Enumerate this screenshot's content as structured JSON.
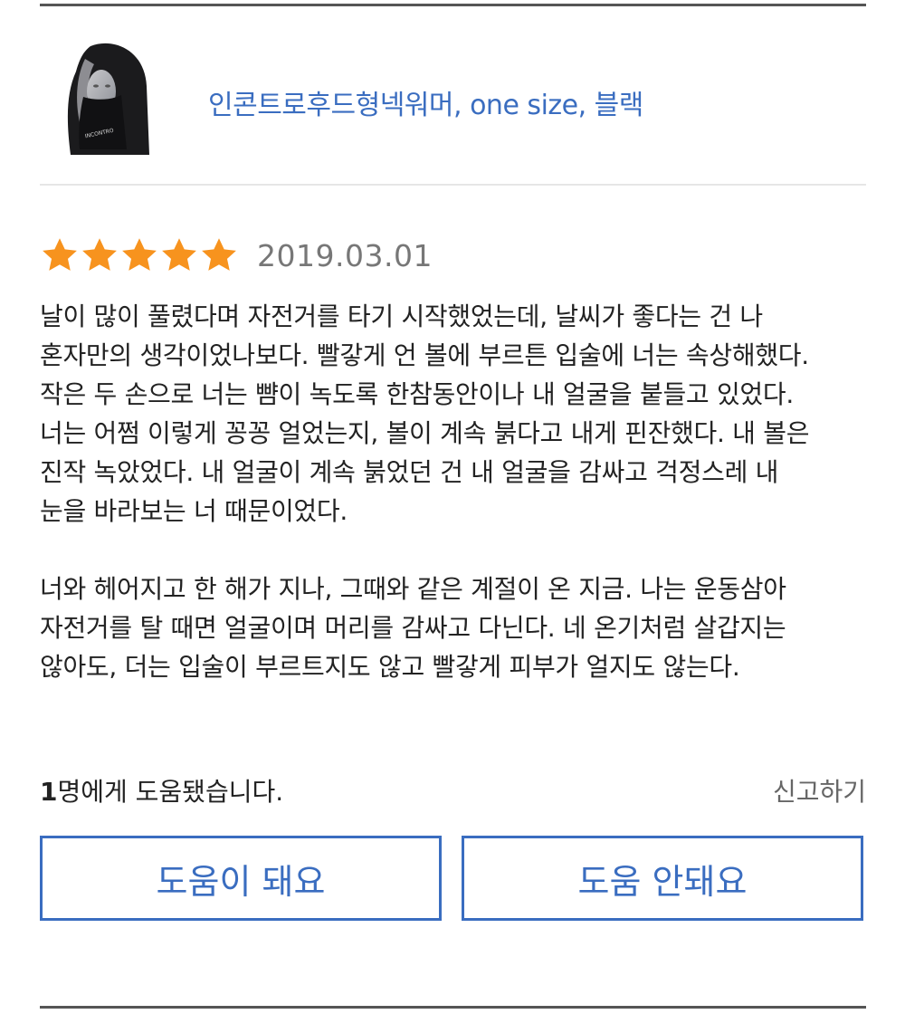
{
  "product": {
    "name": "인콘트로후드형넥워머, one size, 블랙",
    "thumbnail_text": "INCONTRO"
  },
  "review": {
    "rating": 5,
    "rating_max": 5,
    "star_color": "#f7931e",
    "date": "2019.03.01",
    "paragraphs": [
      [
        "날이 많이 풀렸다며 자전거를 타기 시작했었는데, 날씨가 좋다는 건 나",
        "혼자만의 생각이었나보다. 빨갛게 언 볼에 부르튼 입술에 너는 속상해했다.",
        "작은 두 손으로 너는 뺨이 녹도록 한참동안이나 내 얼굴을 붙들고 있었다.",
        "너는 어쩜 이렇게 꽁꽁 얼었는지, 볼이 계속 붉다고 내게 핀잔했다. 내 볼은",
        "진작 녹았었다. 내 얼굴이 계속 붉었던 건 내 얼굴을 감싸고 걱정스레 내",
        "눈을 바라보는 너 때문이었다."
      ],
      [
        "너와 헤어지고 한 해가 지나, 그때와 같은 계절이 온 지금. 나는 운동삼아",
        "자전거를 탈 때면 얼굴이며 머리를 감싸고 다닌다. 네 온기처럼 살갑지는",
        "않아도, 더는 입술이 부르트지도 않고 빨갛게 피부가 얼지도 않는다."
      ]
    ]
  },
  "helpful": {
    "count": "1",
    "suffix": "명에게 도움됐습니다.",
    "report_label": "신고하기"
  },
  "buttons": {
    "helpful_label": "도움이 돼요",
    "not_helpful_label": "도움 안돼요"
  },
  "colors": {
    "accent": "#3a6dc0",
    "star": "#f7931e",
    "date": "#777777",
    "report": "#666666"
  }
}
